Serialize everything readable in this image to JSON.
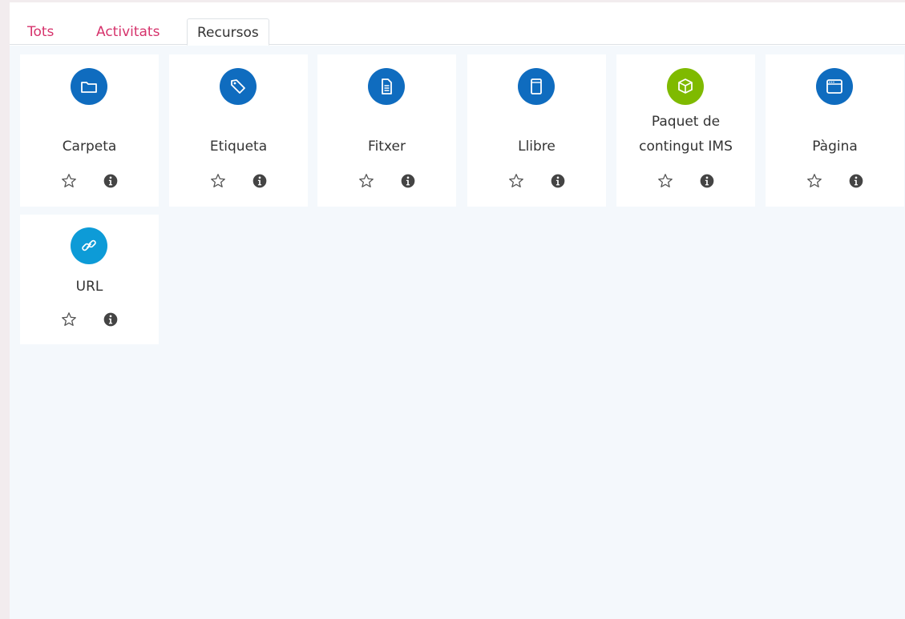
{
  "tabs": [
    {
      "label": "Tots",
      "active": false
    },
    {
      "label": "Activitats",
      "active": false
    },
    {
      "label": "Recursos",
      "active": true
    }
  ],
  "modules": [
    {
      "label": "Carpeta",
      "icon": "folder-icon",
      "color": "#0f6cbf"
    },
    {
      "label": "Etiqueta",
      "icon": "tag-icon",
      "color": "#0f6cbf"
    },
    {
      "label": "Fitxer",
      "icon": "file-icon",
      "color": "#0f6cbf"
    },
    {
      "label": "Llibre",
      "icon": "book-icon",
      "color": "#0f6cbf"
    },
    {
      "label": "Paquet de contingut IMS",
      "label_line1": "Paquet de",
      "label_line2": "contingut IMS",
      "icon": "package-icon",
      "color": "#7fba00"
    },
    {
      "label": "Pàgina",
      "icon": "page-icon",
      "color": "#0f6cbf"
    },
    {
      "label": "URL",
      "icon": "link-icon",
      "color": "#0d9bd7"
    }
  ],
  "colors": {
    "tab_link": "#d6336c",
    "content_bg": "#f4f8fc",
    "text": "#333333"
  }
}
